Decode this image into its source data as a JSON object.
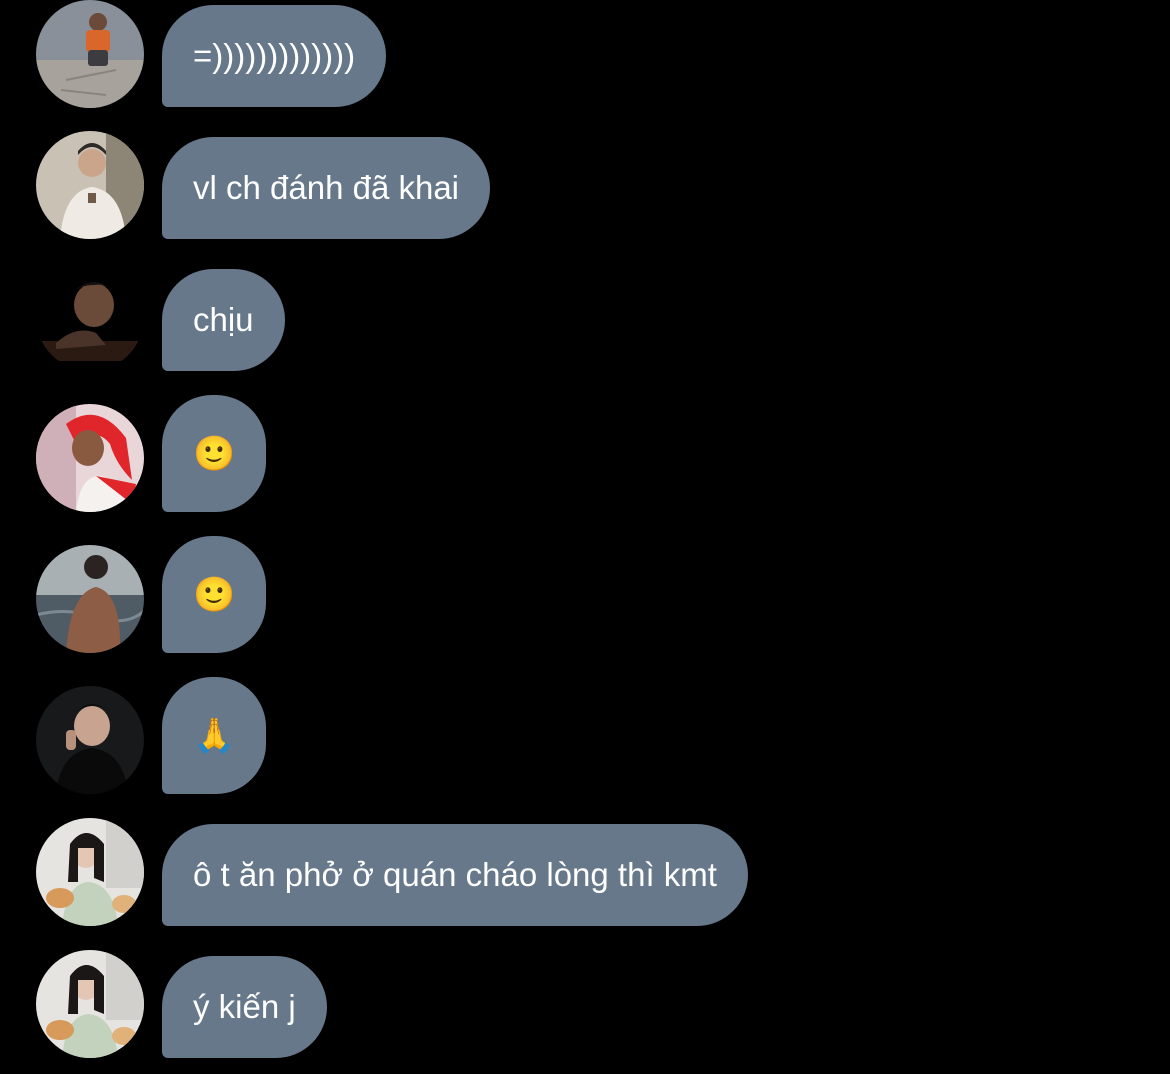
{
  "thread": {
    "background": "#000000",
    "bubble_color": "#66788a",
    "text_color": "#ffffff",
    "messages": [
      {
        "avatar": "avatar-boy-sand",
        "text": "=)))))))))))))"
      },
      {
        "avatar": "avatar-boy-white-jacket",
        "text": "vl ch đánh đã khai"
      },
      {
        "avatar": "avatar-boy-dark",
        "text": "chịu"
      },
      {
        "avatar": "avatar-girl-red-scarf",
        "text": "🙂"
      },
      {
        "avatar": "avatar-boy-sea",
        "text": "🙂"
      },
      {
        "avatar": "avatar-boy-black-shirt",
        "text": "🙏"
      },
      {
        "avatar": "avatar-girl-cats",
        "text": "ô t ăn phở ở quán cháo lòng thì kmt"
      },
      {
        "avatar": "avatar-girl-cats",
        "text": "ý kiến j"
      }
    ]
  }
}
